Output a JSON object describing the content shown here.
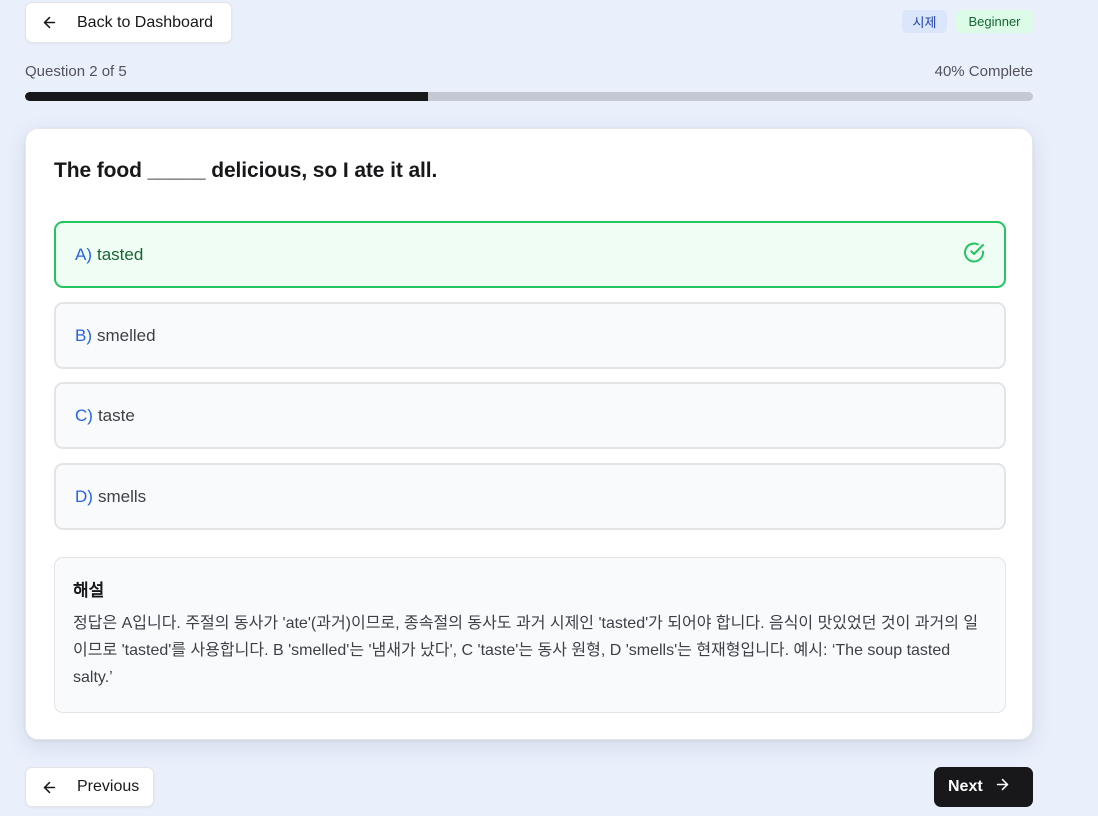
{
  "header": {
    "back_label": "Back to Dashboard",
    "topic_badge": "시제",
    "level_badge": "Beginner"
  },
  "progress": {
    "question_label": "Question 2 of 5",
    "percent_label": "40% Complete",
    "value": 0.4
  },
  "question": {
    "text": "The food _____ delicious, so I ate it all."
  },
  "options": [
    {
      "letter": "A)",
      "text": "tasted",
      "state": "correct"
    },
    {
      "letter": "B)",
      "text": "smelled",
      "state": "default"
    },
    {
      "letter": "C)",
      "text": "taste",
      "state": "default"
    },
    {
      "letter": "D)",
      "text": "smells",
      "state": "default"
    }
  ],
  "explanation": {
    "title": "해설",
    "body": "정답은 A입니다. 주절의 동사가 'ate'(과거)이므로, 종속절의 동사도 과거 시제인 'tasted'가 되어야 합니다. 음식이 맛있었던 것이 과거의 일이므로 'tasted'를 사용합니다. B 'smelled'는 '냄새가 났다', C 'taste'는 동사 원형, D 'smells'는 현재형입니다. 예시: ‘The soup tasted salty.’"
  },
  "footer": {
    "previous_label": "Previous",
    "next_label": "Next"
  },
  "icons": {
    "back": "arrow-left-icon",
    "previous": "arrow-left-icon",
    "next": "arrow-right-icon",
    "correct": "circle-check-icon"
  },
  "colors": {
    "correct_border": "#22c55e",
    "correct_bg": "#f0fdf4",
    "option_letter": "#2563eb",
    "progress_fill": "#18181b",
    "primary_button": "#18181b"
  }
}
